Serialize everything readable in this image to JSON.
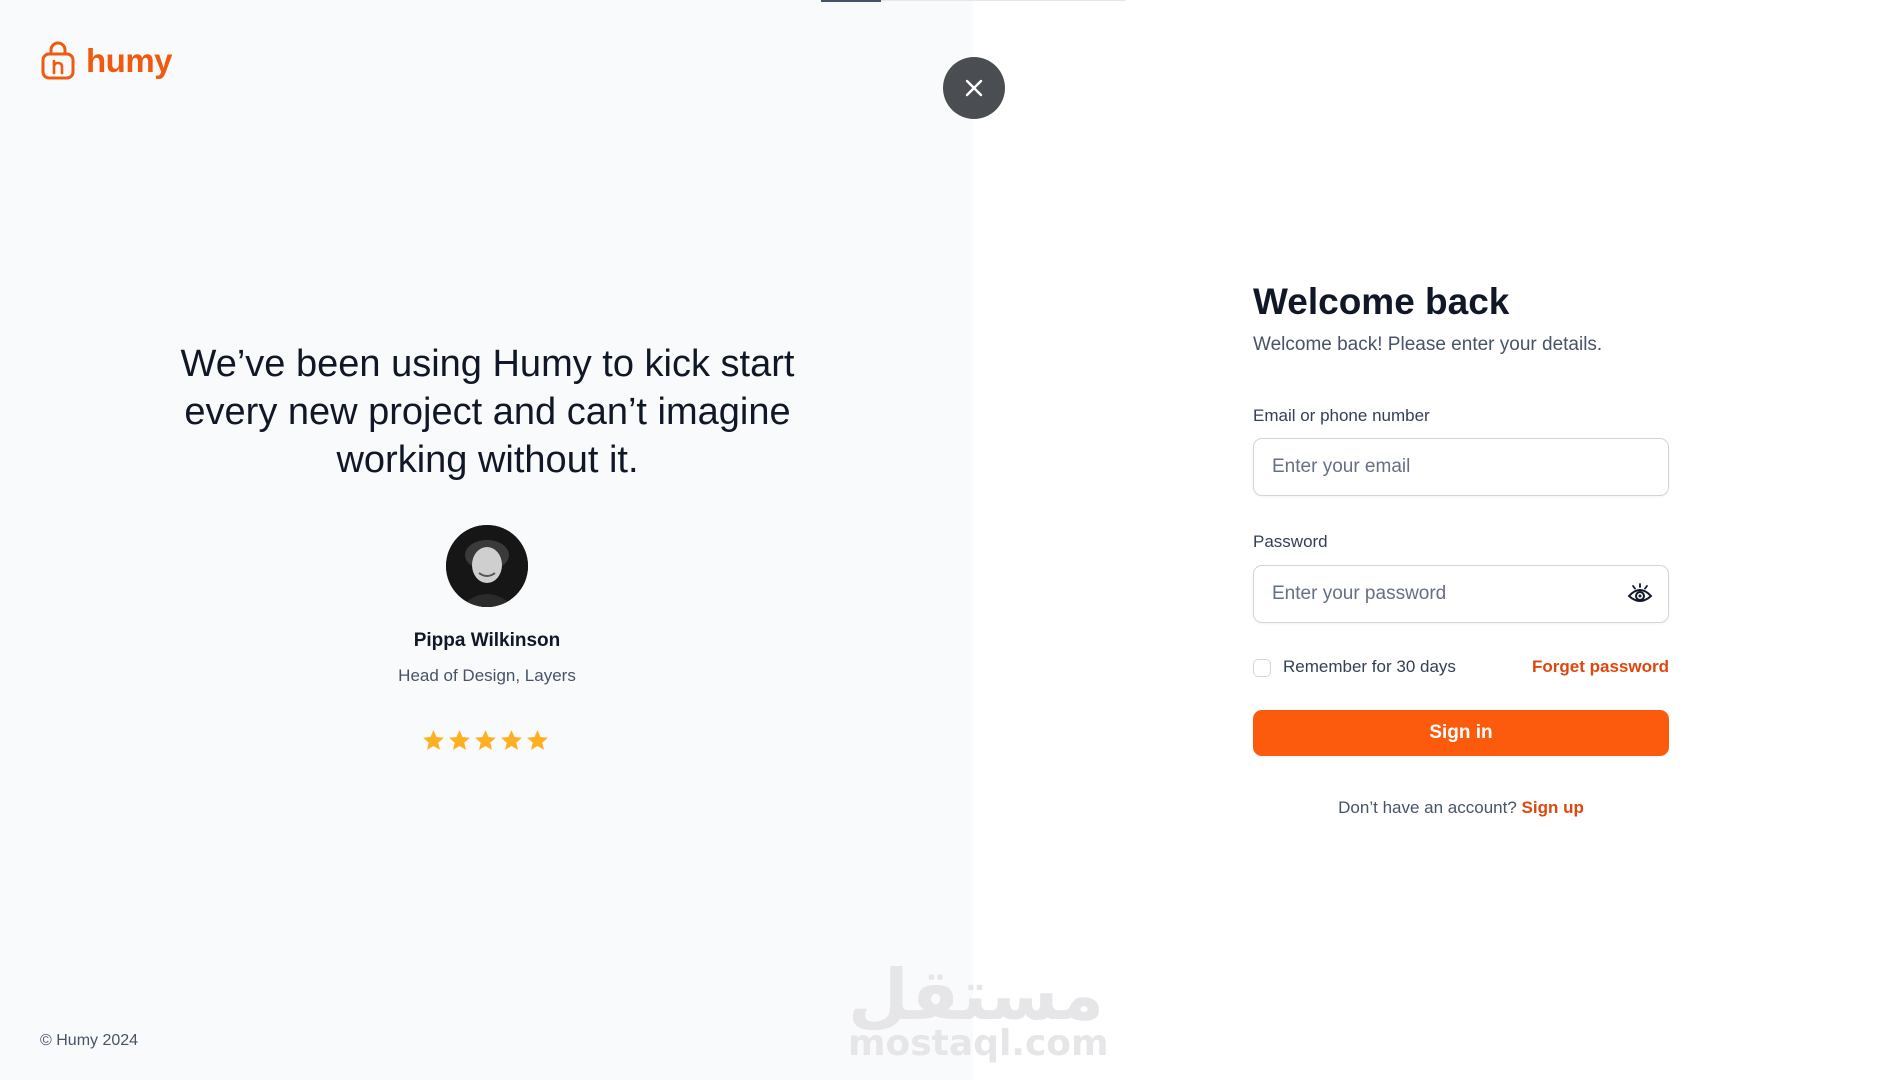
{
  "brand": {
    "name": "humy",
    "accent_color": "#f05a0e",
    "primary_button_color": "#fc5a0c"
  },
  "close_button": {
    "icon": "close-icon"
  },
  "testimonial": {
    "quote": "We’ve been using Humy to kick start every new project and can’t imagine working without it.",
    "name": "Pippa Wilkinson",
    "role": "Head of Design, Layers",
    "rating": 5,
    "rating_max": 5
  },
  "footer": {
    "copyright": "© Humy 2024"
  },
  "form": {
    "title": "Welcome back",
    "subtitle": "Welcome back! Please enter your details.",
    "email_label": "Email or phone number",
    "email_placeholder": "Enter your email",
    "email_value": "",
    "password_label": "Password",
    "password_placeholder": "Enter your password",
    "password_value": "",
    "remember_label": "Remember for 30 days",
    "remember_checked": false,
    "forgot_label": "Forget password",
    "signin_label": "Sign in",
    "signup_prompt": "Don’t have an account?",
    "signup_label": "Sign up"
  },
  "watermark": {
    "arabic": "مستقل",
    "latin": "mostaql.com"
  }
}
